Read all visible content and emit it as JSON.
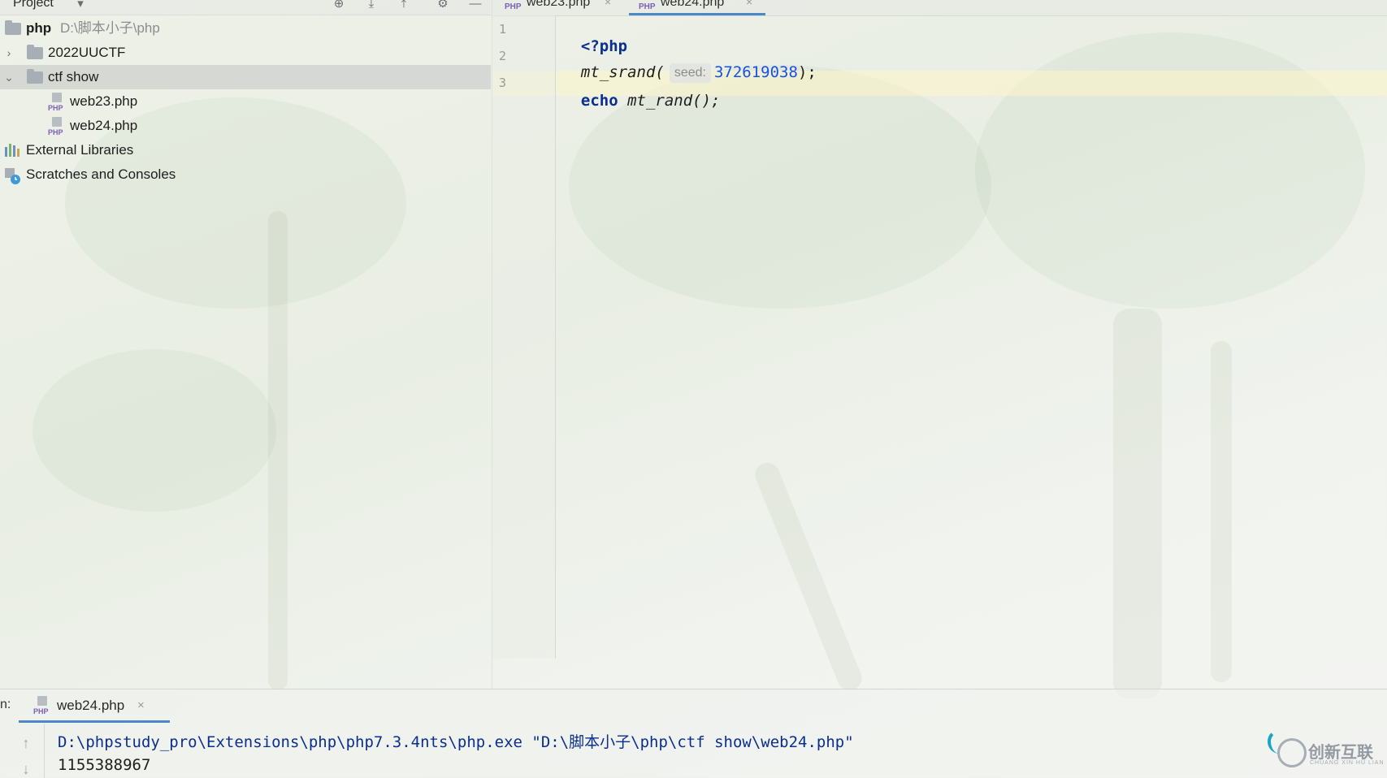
{
  "project_panel": {
    "header_title": "Project",
    "tree": [
      {
        "label": "php",
        "path": "D:\\脚本小子\\php",
        "type": "root-folder"
      },
      {
        "label": "2022UUCTF",
        "type": "folder",
        "expanded": false
      },
      {
        "label": "ctf show",
        "type": "folder",
        "expanded": true,
        "selected": true
      },
      {
        "label": "web23.php",
        "type": "php-file"
      },
      {
        "label": "web24.php",
        "type": "php-file"
      },
      {
        "label": "External Libraries",
        "type": "libraries"
      },
      {
        "label": "Scratches and Consoles",
        "type": "scratches"
      }
    ]
  },
  "editor": {
    "tabs": [
      {
        "label": "web23.php",
        "file_badge": "PHP",
        "active": false
      },
      {
        "label": "web24.php",
        "file_badge": "PHP",
        "active": true
      }
    ],
    "lines": [
      {
        "number": "1",
        "open_tag": "<?php"
      },
      {
        "number": "2",
        "func": "mt_srand(",
        "hint": "seed:",
        "value": "372619038",
        "close": ");"
      },
      {
        "number": "3",
        "keyword": "echo",
        "func": " mt_rand();"
      }
    ]
  },
  "run_panel": {
    "prefix": "n:",
    "tab_label": "web24.php",
    "file_badge": "PHP",
    "command": "D:\\phpstudy_pro\\Extensions\\php\\php7.3.4nts\\php.exe \"D:\\脚本小子\\php\\ctf show\\web24.php\"",
    "output": "1155388967"
  },
  "watermark": {
    "text": "创新互联",
    "subtext": "CHUANG XIN HU LIAN"
  },
  "colors": {
    "keyword": "#0a2f8c",
    "number": "#1750eb",
    "tab_underline": "#4a88c7",
    "current_line": "#fdf5c8",
    "php_badge": "#7c5fb4"
  }
}
